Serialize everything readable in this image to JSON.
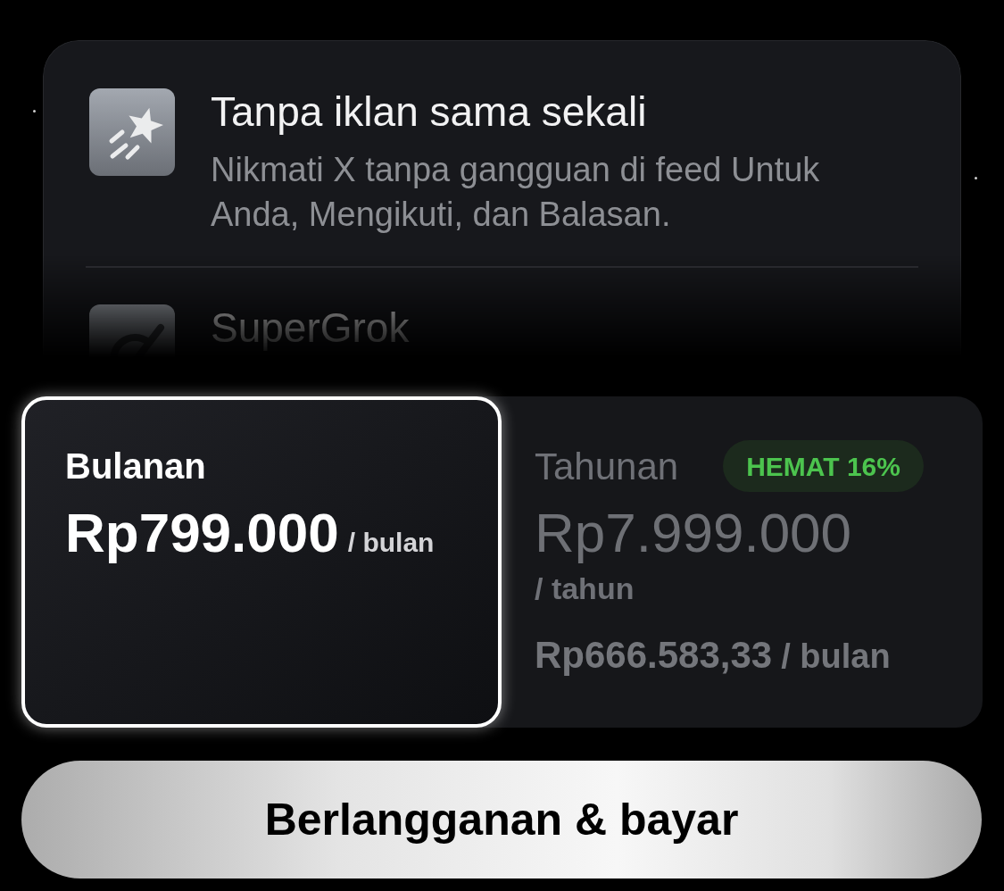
{
  "features": [
    {
      "title": "Tanpa iklan sama sekali",
      "description": "Nikmati X tanpa gangguan di feed Untuk Anda, Mengikuti, dan Balasan."
    },
    {
      "title": "SuperGrok"
    }
  ],
  "plans": [
    {
      "name": "Bulanan",
      "selected": true,
      "price": "Rp799.000",
      "unit": "/ bulan"
    },
    {
      "name": "Tahunan",
      "selected": false,
      "badge": "HEMAT 16%",
      "price": "Rp7.999.000",
      "unit": "/ tahun",
      "monthly_price": "Rp666.583,33",
      "monthly_unit": "/ bulan"
    }
  ],
  "subscribe_button": {
    "label": "Berlangganan & bayar"
  }
}
